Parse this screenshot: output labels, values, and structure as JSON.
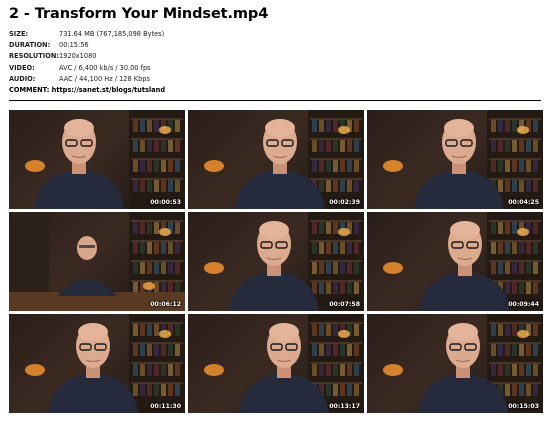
{
  "title": "2 - Transform Your Mindset.mp4",
  "meta": {
    "size_label": "SIZE:",
    "size_value": "731.64 MB (767,185,098 Bytes)",
    "duration_label": "DURATION:",
    "duration_value": "00:15:56",
    "resolution_label": "RESOLUTION:",
    "resolution_value": "1920x1080",
    "video_label": "VIDEO:",
    "video_value": "AVC / 6,400 kb/s / 30.00 fps",
    "audio_label": "AUDIO:",
    "audio_value": "AAC / 44,100 Hz / 128 Kbps",
    "comment": "COMMENT: https://sanet.st/blogs/tutsland"
  },
  "thumbnails": [
    {
      "timestamp": "00:00:53"
    },
    {
      "timestamp": "00:02:39"
    },
    {
      "timestamp": "00:04:25"
    },
    {
      "timestamp": "00:06:12"
    },
    {
      "timestamp": "00:07:58"
    },
    {
      "timestamp": "00:09:44"
    },
    {
      "timestamp": "00:11:30"
    },
    {
      "timestamp": "00:13:17"
    },
    {
      "timestamp": "00:15:03"
    }
  ]
}
